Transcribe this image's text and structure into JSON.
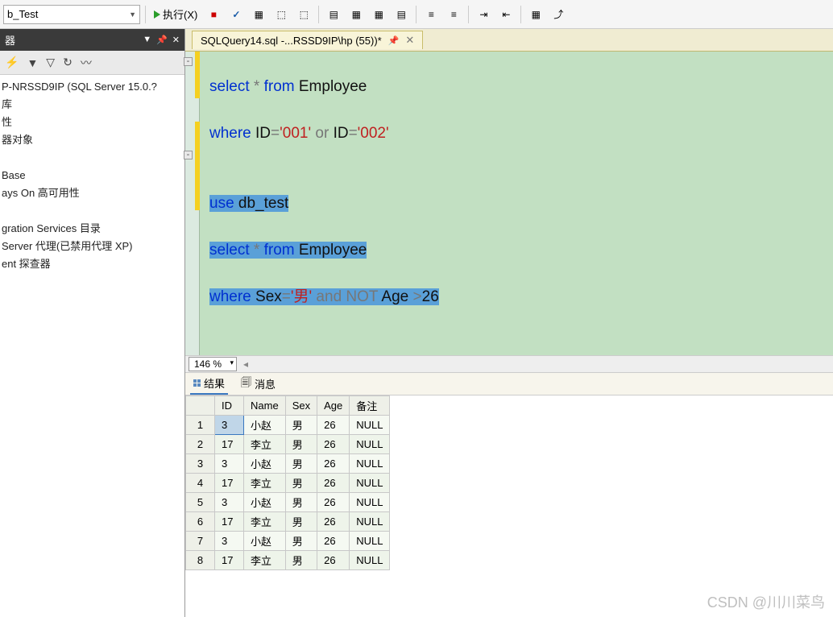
{
  "toolbar": {
    "db_selected": "b_Test",
    "execute_label": "执行(X)"
  },
  "side_panel": {
    "title": "器",
    "tree": [
      "P-NRSSD9IP (SQL Server 15.0.?",
      "库",
      "性",
      "器对象",
      "",
      "Base",
      "ays On 高可用性",
      "",
      "gration Services 目录",
      "Server 代理(已禁用代理 XP)",
      "ent 探查器"
    ]
  },
  "tab": {
    "label": "SQLQuery14.sql -...RSSD9IP\\hp (55))*"
  },
  "sql": {
    "line1": {
      "a": "select",
      "b": " * ",
      "c": "from",
      "d": " Employee"
    },
    "line2": {
      "a": "where",
      "b": " ID",
      "c": "=",
      "d": "'001'",
      "e": " or ",
      "f": "ID",
      "g": "=",
      "h": "'002'"
    },
    "line3": "",
    "line4": {
      "a": "use",
      "b": " db_test"
    },
    "line5": {
      "a": "select",
      "b": " * ",
      "c": "from",
      "d": " Employee"
    },
    "line6": {
      "a": "where",
      "b": " Sex",
      "c": "=",
      "d": "'男'",
      "e": " and ",
      "f": "NOT",
      "g": " Age ",
      "h": ">",
      "i": "26"
    }
  },
  "zoom": "146 %",
  "results": {
    "tab_results": "结果",
    "tab_messages": "消息",
    "columns": [
      "ID",
      "Name",
      "Sex",
      "Age",
      "备注"
    ],
    "rows": [
      {
        "n": "1",
        "cells": [
          "3",
          "小赵",
          "男",
          "26",
          "NULL"
        ]
      },
      {
        "n": "2",
        "cells": [
          "17",
          "李立",
          "男",
          "26",
          "NULL"
        ]
      },
      {
        "n": "3",
        "cells": [
          "3",
          "小赵",
          "男",
          "26",
          "NULL"
        ]
      },
      {
        "n": "4",
        "cells": [
          "17",
          "李立",
          "男",
          "26",
          "NULL"
        ]
      },
      {
        "n": "5",
        "cells": [
          "3",
          "小赵",
          "男",
          "26",
          "NULL"
        ]
      },
      {
        "n": "6",
        "cells": [
          "17",
          "李立",
          "男",
          "26",
          "NULL"
        ]
      },
      {
        "n": "7",
        "cells": [
          "3",
          "小赵",
          "男",
          "26",
          "NULL"
        ]
      },
      {
        "n": "8",
        "cells": [
          "17",
          "李立",
          "男",
          "26",
          "NULL"
        ]
      }
    ]
  },
  "watermark": "CSDN @川川菜鸟"
}
